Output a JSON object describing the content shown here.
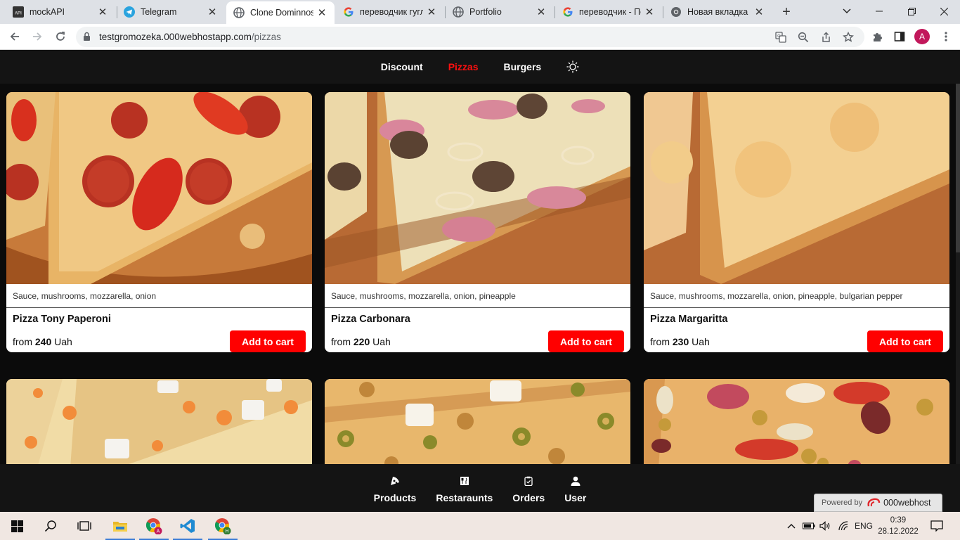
{
  "browser": {
    "tabs": [
      {
        "title": "mockAPI",
        "icon": "mockapi-favicon"
      },
      {
        "title": "Telegram",
        "icon": "telegram-favicon"
      },
      {
        "title": "Clone Dominnos",
        "icon": "globe-favicon"
      },
      {
        "title": "переводчик гугл",
        "icon": "google-favicon"
      },
      {
        "title": "Portfolio",
        "icon": "globe-favicon"
      },
      {
        "title": "переводчик - По",
        "icon": "google-favicon"
      },
      {
        "title": "Новая вкладка",
        "icon": "chrome-favicon"
      }
    ],
    "active_tab": 2,
    "url_host": "testgromozeka.000webhostapp.com",
    "url_path": "/pizzas",
    "profile_initial": "A"
  },
  "site": {
    "nav": {
      "discount": "Discount",
      "pizzas": "Pizzas",
      "burgers": "Burgers"
    },
    "active_nav": "pizzas",
    "accent_color": "#ff0000",
    "products": [
      {
        "name": "Pizza Tony Paperoni",
        "ingredients": "Sauce, mushrooms, mozzarella, onion",
        "price_prefix": "from",
        "price": "240",
        "currency": "Uah",
        "button": "Add to cart"
      },
      {
        "name": "Pizza Carbonara",
        "ingredients": "Sauce, mushrooms, mozzarella, onion, pineapple",
        "price_prefix": "from",
        "price": "220",
        "currency": "Uah",
        "button": "Add to cart"
      },
      {
        "name": "Pizza Margaritta",
        "ingredients": "Sauce, mushrooms, mozzarella, onion, pineapple, bulgarian pepper",
        "price_prefix": "from",
        "price": "230",
        "currency": "Uah",
        "button": "Add to cart"
      }
    ],
    "bottom_nav": {
      "products": "Products",
      "restaurants": "Restaraunts",
      "orders": "Orders",
      "user": "User"
    },
    "powered_by": "Powered by",
    "powered_brand": "000webhost"
  },
  "taskbar": {
    "language": "ENG",
    "time": "0:39",
    "date": "28.12.2022",
    "chrome_badge_1": "A",
    "chrome_badge_2": "H"
  }
}
